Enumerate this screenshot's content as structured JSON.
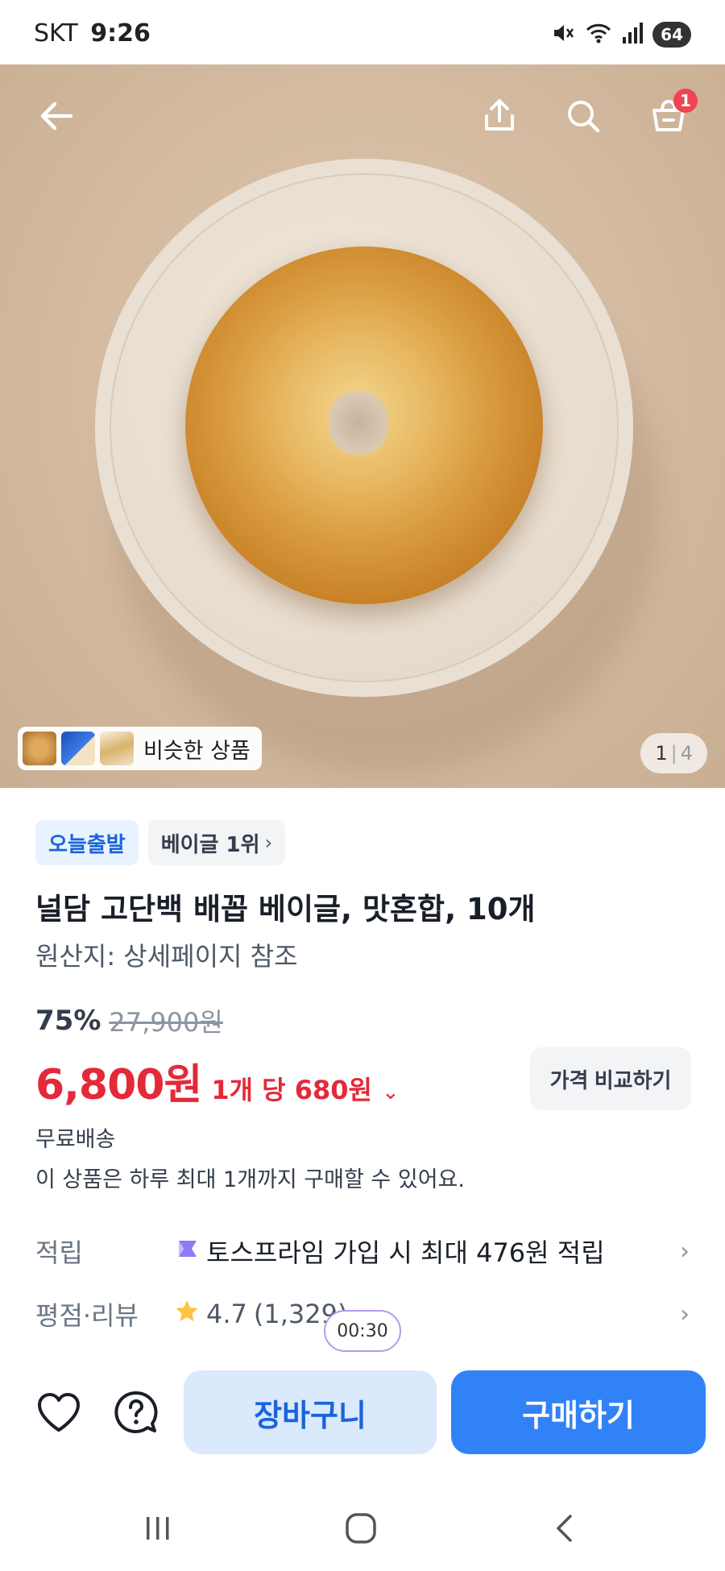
{
  "status_bar": {
    "carrier": "SKT",
    "time": "9:26",
    "battery": "64",
    "icons": [
      "mute-icon",
      "wifi-icon",
      "signal-icon",
      "battery-icon"
    ]
  },
  "hero": {
    "icons": [
      "back-arrow-icon",
      "share-icon",
      "search-icon",
      "cart-icon"
    ],
    "cart_count": "1",
    "similar_label": "비슷한 상품",
    "page_current": "1",
    "page_separator": "|",
    "page_total": "4"
  },
  "product": {
    "badge_today": "오늘출발",
    "badge_rank": "베이글 1위",
    "badge_chevron": "›",
    "title": "널담 고단백 배꼽 베이글, 맛혼합, 10개",
    "origin": "원산지: 상세페이지 참조",
    "discount": "75%",
    "original_price": "27,900원",
    "price": "6,800원",
    "unit_price": "1개 당 680원",
    "unit_chevron": "⌄",
    "compare_label": "가격 비교하기",
    "shipping": "무료배송",
    "limit_notice": "이 상품은 하루 최대 1개까지 구매할 수 있어요."
  },
  "info": {
    "points_label": "적립",
    "points_value": "토스프라임 가입 시 최대 476원 적립",
    "review_label": "평점·리뷰",
    "rating": "4.7",
    "review_count": "(1,329)",
    "chevron": "›"
  },
  "timer": "00:30",
  "actions": {
    "cart_label": "장바구니",
    "buy_label": "구매하기",
    "icons": [
      "heart-icon",
      "question-icon"
    ]
  },
  "colors": {
    "accent": "#3182f6",
    "price_red": "#e42939",
    "badge_blue": "#1b64da"
  }
}
